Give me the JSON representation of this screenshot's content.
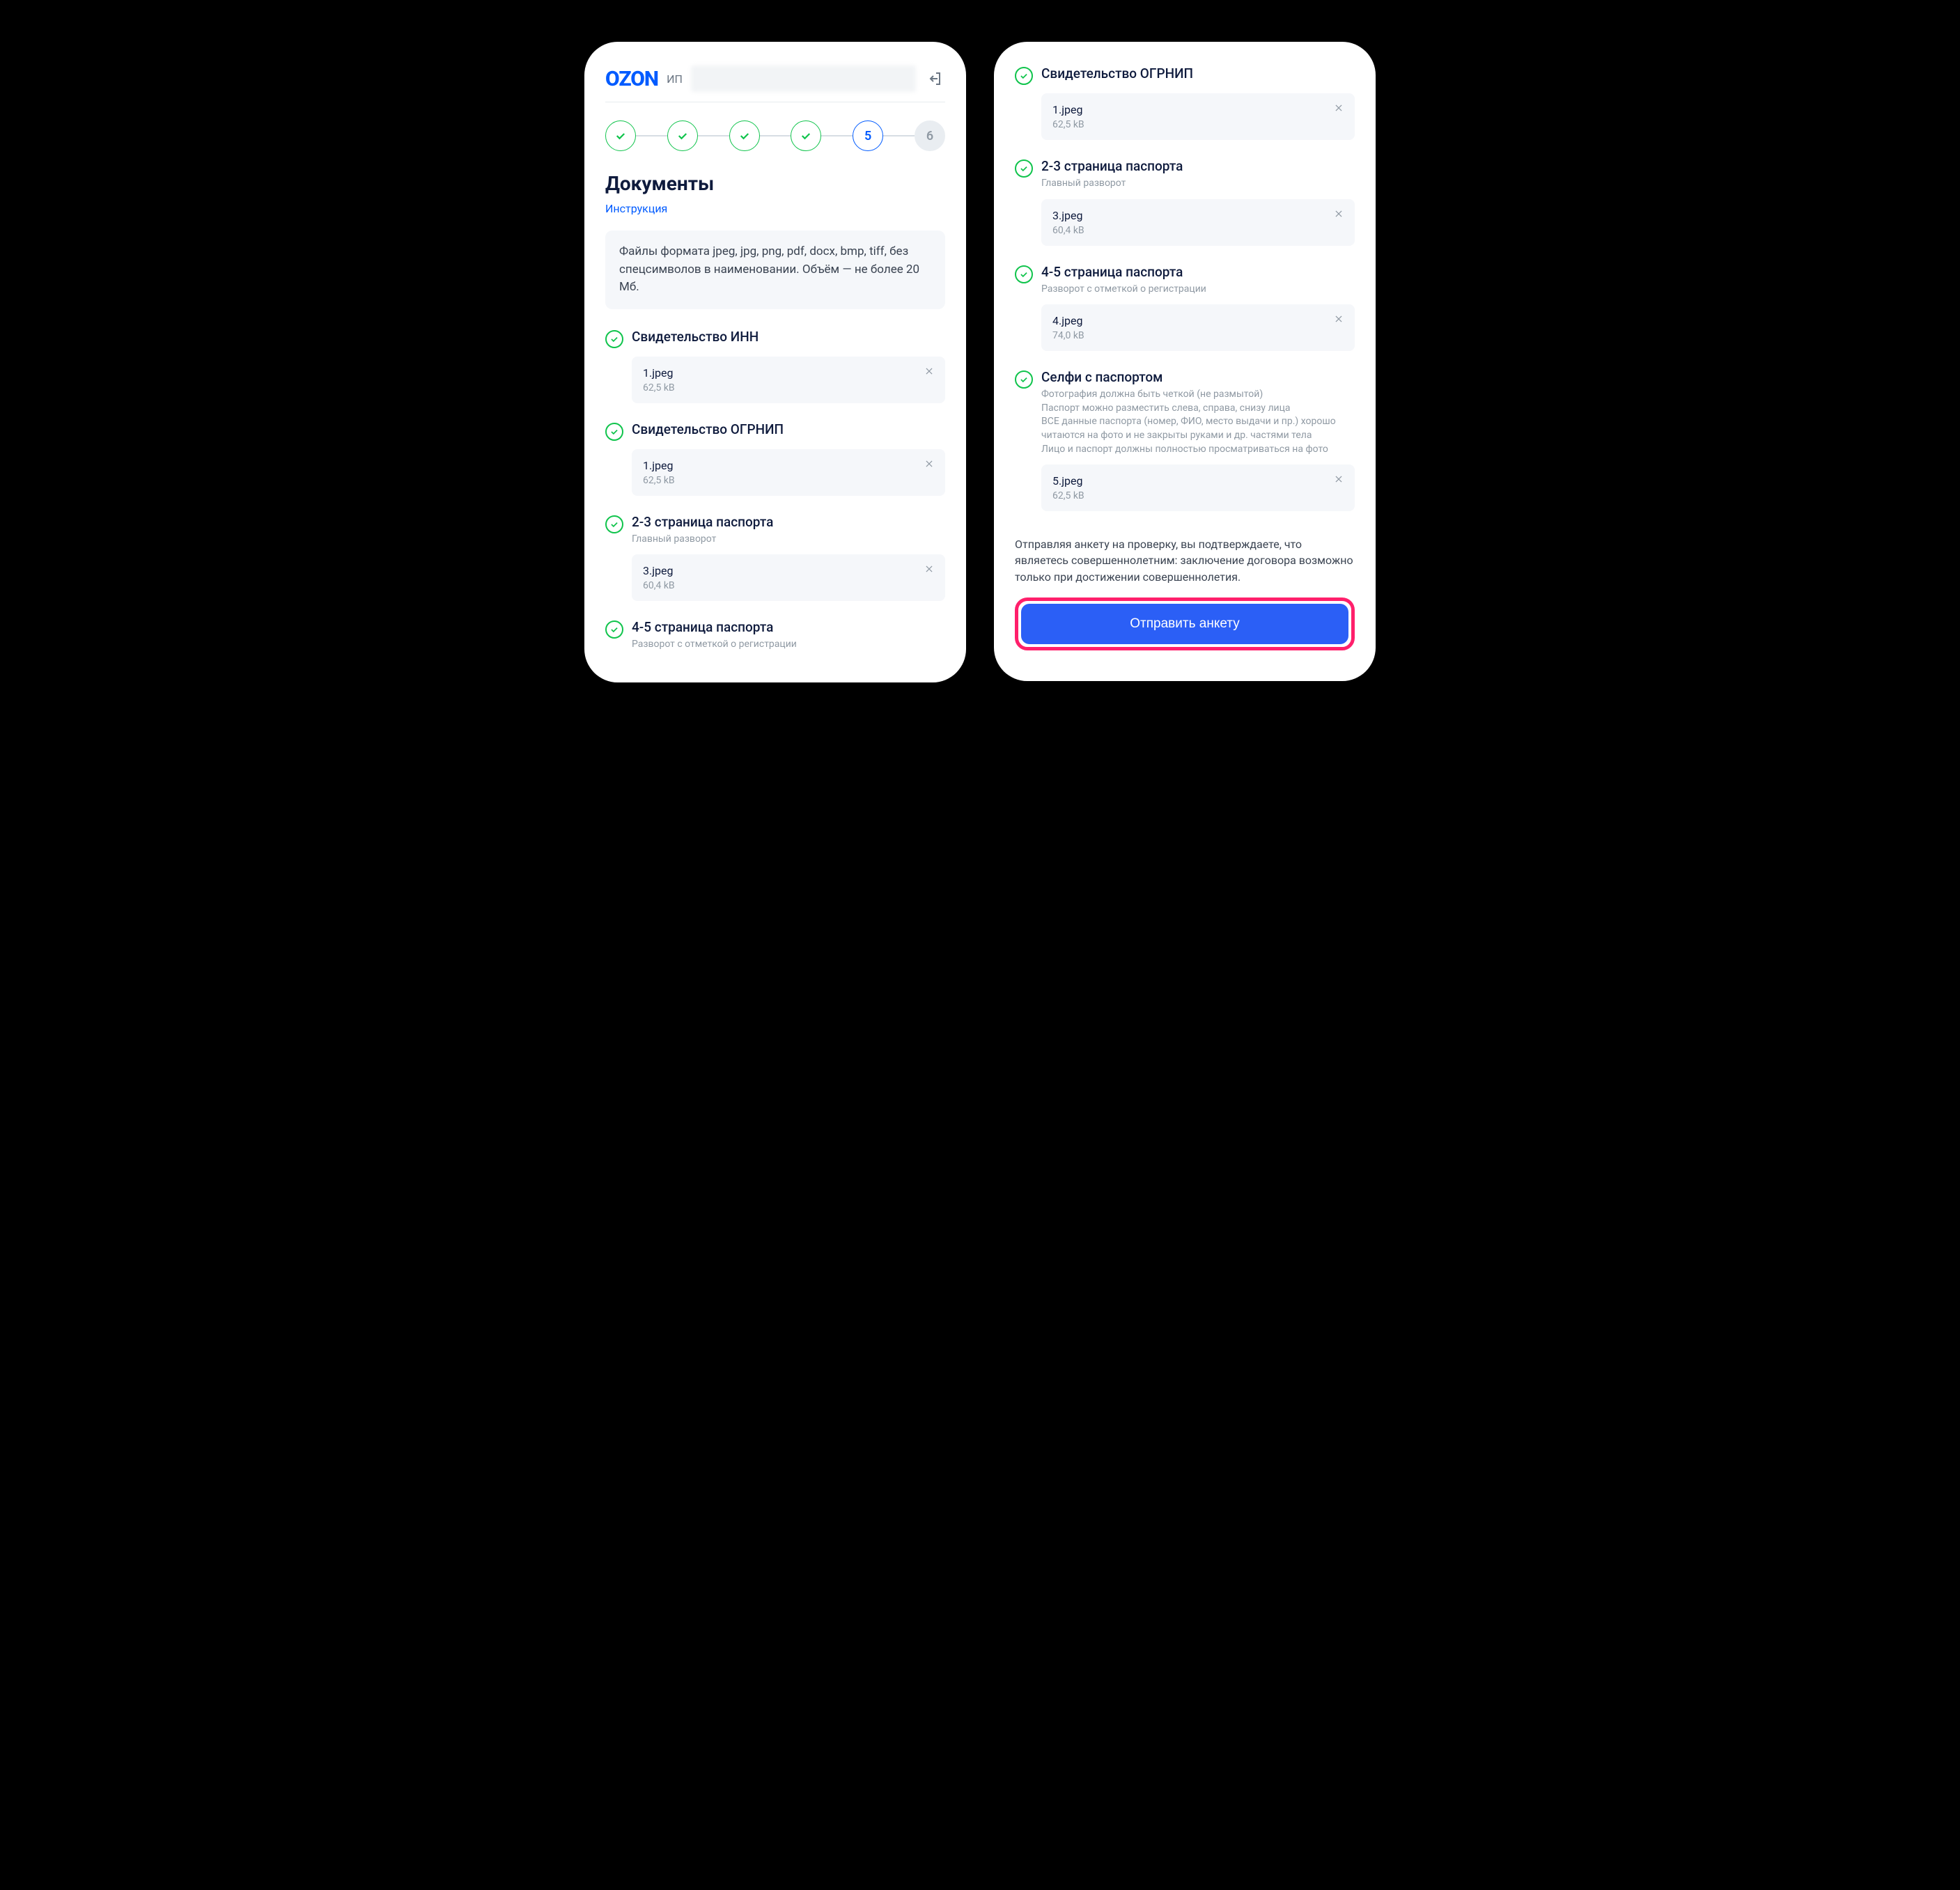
{
  "header": {
    "logo": "OZON",
    "user_prefix": "ИП"
  },
  "stepper": {
    "steps": [
      {
        "state": "done"
      },
      {
        "state": "done"
      },
      {
        "state": "done"
      },
      {
        "state": "done"
      },
      {
        "state": "current",
        "label": "5"
      },
      {
        "state": "future",
        "label": "6"
      }
    ]
  },
  "page": {
    "title": "Документы",
    "instruction_link": "Инструкция",
    "info": "Файлы формата jpeg, jpg, png, pdf, docx, bmp, tiff, без спецсимволов в наименовании. Объём — не более 20 Мб."
  },
  "docs_left": [
    {
      "title": "Свидетельство ИНН",
      "subtitle": "",
      "file": {
        "name": "1.jpeg",
        "size": "62,5 kB"
      }
    },
    {
      "title": "Свидетельство ОГРНИП",
      "subtitle": "",
      "file": {
        "name": "1.jpeg",
        "size": "62,5 kB"
      }
    },
    {
      "title": "2-3 страница паспорта",
      "subtitle": "Главный разворот",
      "file": {
        "name": "3.jpeg",
        "size": "60,4 kB"
      }
    },
    {
      "title": "4-5 страница паспорта",
      "subtitle": "Разворот с отметкой о регистрации",
      "file": null
    }
  ],
  "docs_right": [
    {
      "title": "Свидетельство ОГРНИП",
      "subtitle": "",
      "file": {
        "name": "1.jpeg",
        "size": "62,5 kB"
      }
    },
    {
      "title": "2-3 страница паспорта",
      "subtitle": "Главный разворот",
      "file": {
        "name": "3.jpeg",
        "size": "60,4 kB"
      }
    },
    {
      "title": "4-5 страница паспорта",
      "subtitle": "Разворот с отметкой о регистрации",
      "file": {
        "name": "4.jpeg",
        "size": "74,0 kB"
      }
    },
    {
      "title": "Селфи с паспортом",
      "subtitle": "Фотография должна быть четкой (не размытой)\nПаспорт можно разместить слева, справа, снизу лица\nВСЕ данные паспорта (номер, ФИО, место выдачи и пр.) хорошо читаются на фото и не закрыты руками и др. частями тела\nЛицо и паспорт должны полностью просматриваться на фото",
      "file": {
        "name": "5.jpeg",
        "size": "62,5 kB"
      }
    }
  ],
  "consent": "Отправляя анкету на проверку, вы подтверждаете, что являетесь совершеннолетним: заключение договора возможно только при достижении совершеннолетия.",
  "submit_label": "Отправить анкету"
}
